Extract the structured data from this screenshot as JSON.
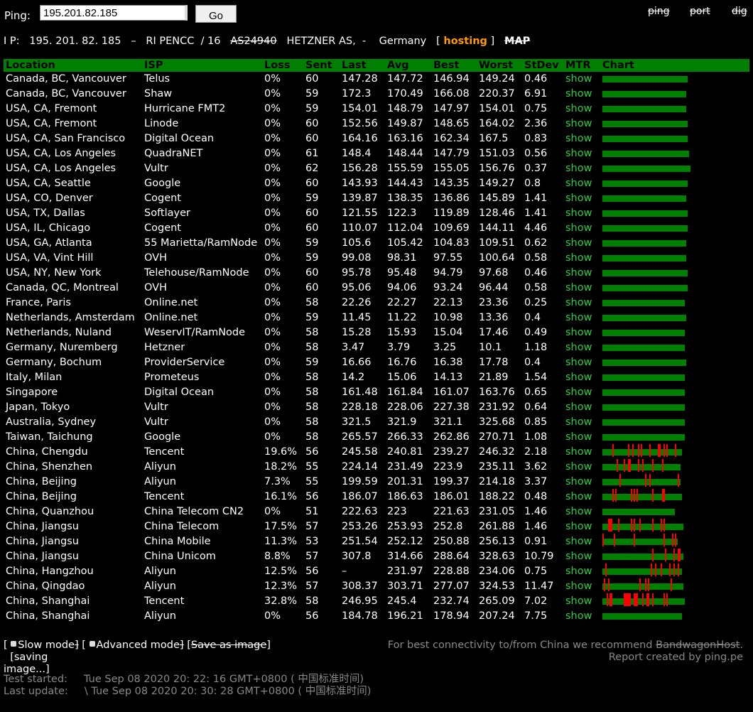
{
  "header": {
    "ping_label": "Ping:",
    "ping_value": "195.201.82.185",
    "go_label": "Go",
    "links": [
      "ping",
      "port",
      "dig"
    ]
  },
  "ipinfo": {
    "ip_label": "I P:",
    "ip": "195. 201. 82. 185",
    "sep1": "–",
    "registry": "RI PENCC",
    "prefix": "/ 16",
    "asn": "AS24940",
    "asname": "HETZNER AS,",
    "sep2": "-",
    "country": "Germany",
    "bracket_open": "[",
    "hosting": "hosting",
    "bracket_close": "]",
    "map": "MAP"
  },
  "table": {
    "columns": [
      "Location",
      "ISP",
      "Loss",
      "Sent",
      "Last",
      "Avg",
      "Best",
      "Worst",
      "StDev",
      "MTR",
      "Chart"
    ],
    "rows": [
      {
        "location": "Canada,  BC,  Vancouver",
        "isp": "Telus",
        "loss": "0%",
        "sent": "60",
        "last": "147.28",
        "avg": "147.72",
        "best": "146.94",
        "worst": "149.24",
        "stdev": "0.46",
        "mtr": "show"
      },
      {
        "location": "Canada,  BC,  Vancouver",
        "isp": "Shaw",
        "loss": "0%",
        "sent": "59",
        "last": "172.3",
        "avg": "170.49",
        "best": "166.08",
        "worst": "220.37",
        "stdev": "6.91",
        "mtr": "show"
      },
      {
        "location": "USA,  CA,  Fremont",
        "isp": "Hurricane    FMT2",
        "loss": "0%",
        "sent": "59",
        "last": "154.01",
        "avg": "148.79",
        "best": "147.97",
        "worst": "154.01",
        "stdev": "0.75",
        "mtr": "show"
      },
      {
        "location": "USA,  CA,  Fremont",
        "isp": "Linode",
        "loss": "0%",
        "sent": "60",
        "last": "152.56",
        "avg": "149.87",
        "best": "148.65",
        "worst": "164.02",
        "stdev": "2.36",
        "mtr": "show"
      },
      {
        "location": "USA,  CA,  San  Francisco",
        "isp": "Digital     Ocean",
        "loss": "0%",
        "sent": "60",
        "last": "164.16",
        "avg": "163.16",
        "best": "162.34",
        "worst": "167.5",
        "stdev": "0.83",
        "mtr": "show"
      },
      {
        "location": "USA,  CA,  Los  Angeles",
        "isp": "QuadraNET",
        "loss": "0%",
        "sent": "61",
        "last": "148.4",
        "avg": "148.44",
        "best": "147.79",
        "worst": "151.03",
        "stdev": "0.56",
        "mtr": "show"
      },
      {
        "location": "USA,  CA,  Los  Angeles",
        "isp": "Vultr",
        "loss": "0%",
        "sent": "62",
        "last": "156.28",
        "avg": "155.59",
        "best": "155.05",
        "worst": "156.76",
        "stdev": "0.37",
        "mtr": "show"
      },
      {
        "location": "USA,  CA,  Seattle",
        "isp": "Google",
        "loss": "0%",
        "sent": "60",
        "last": "143.93",
        "avg": "144.43",
        "best": "143.35",
        "worst": "149.27",
        "stdev": "0.8",
        "mtr": "show"
      },
      {
        "location": "USA,  CO,  Denver",
        "isp": "Cogent",
        "loss": "0%",
        "sent": "59",
        "last": "139.87",
        "avg": "138.35",
        "best": "136.86",
        "worst": "145.89",
        "stdev": "1.41",
        "mtr": "show"
      },
      {
        "location": "USA,  TX,  Dallas",
        "isp": "Softlayer",
        "loss": "0%",
        "sent": "60",
        "last": "121.55",
        "avg": "122.3",
        "best": "119.89",
        "worst": "128.46",
        "stdev": "1.41",
        "mtr": "show"
      },
      {
        "location": "USA,  IL,   Chicago",
        "isp": "Cogent",
        "loss": "0%",
        "sent": "60",
        "last": "110.07",
        "avg": "112.04",
        "best": "109.69",
        "worst": "144.11",
        "stdev": "4.46",
        "mtr": "show"
      },
      {
        "location": "USA,  GA,  Atlanta",
        "isp": "55  Marietta/RamNode",
        "loss": "0%",
        "sent": "59",
        "last": "105.6",
        "avg": "105.42",
        "best": "104.83",
        "worst": "109.51",
        "stdev": "0.62",
        "mtr": "show"
      },
      {
        "location": "USA,  VA,  Vint   Hill",
        "isp": "OVH",
        "loss": "0%",
        "sent": "59",
        "last": "99.08",
        "avg": "98.31",
        "best": "97.55",
        "worst": "100.64",
        "stdev": "0.58",
        "mtr": "show"
      },
      {
        "location": "USA,  NY,  New York",
        "isp": "Telehouse/RamNode",
        "loss": "0%",
        "sent": "60",
        "last": "95.78",
        "avg": "95.48",
        "best": "94.79",
        "worst": "97.68",
        "stdev": "0.46",
        "mtr": "show"
      },
      {
        "location": "Canada,   QC,  Montreal",
        "isp": "OVH",
        "loss": "0%",
        "sent": "60",
        "last": "95.06",
        "avg": "94.06",
        "best": "93.24",
        "worst": "96.44",
        "stdev": "0.58",
        "mtr": "show"
      },
      {
        "location": "France,     Paris",
        "isp": "Online.net",
        "loss": "0%",
        "sent": "58",
        "last": "22.26",
        "avg": "22.27",
        "best": "22.13",
        "worst": "23.36",
        "stdev": "0.25",
        "mtr": "show"
      },
      {
        "location": "Netherlands,     Amsterdam",
        "isp": "Online.net",
        "loss": "0%",
        "sent": "59",
        "last": "11.45",
        "avg": "11.22",
        "best": "10.98",
        "worst": "13.36",
        "stdev": "0.4",
        "mtr": "show"
      },
      {
        "location": "Netherlands,     Nuland",
        "isp": "WeservIT/RamNode",
        "loss": "0%",
        "sent": "58",
        "last": "15.28",
        "avg": "15.93",
        "best": "15.04",
        "worst": "17.46",
        "stdev": "0.49",
        "mtr": "show"
      },
      {
        "location": "Germany,   Nuremberg",
        "isp": "Hetzner",
        "loss": "0%",
        "sent": "58",
        "last": "3.47",
        "avg": "3.79",
        "best": "3.25",
        "worst": "10.1",
        "stdev": "1.18",
        "mtr": "show"
      },
      {
        "location": "Germany,   Bochum",
        "isp": "ProviderService",
        "loss": "0%",
        "sent": "59",
        "last": "16.66",
        "avg": "16.76",
        "best": "16.38",
        "worst": "17.78",
        "stdev": "0.4",
        "mtr": "show"
      },
      {
        "location": "Italy,      Milan",
        "isp": "Prometeus",
        "loss": "0%",
        "sent": "58",
        "last": "14.2",
        "avg": "15.06",
        "best": "14.13",
        "worst": "21.89",
        "stdev": "1.54",
        "mtr": "show"
      },
      {
        "location": "Singapore",
        "isp": "Digital     Ocean",
        "loss": "0%",
        "sent": "58",
        "last": "161.48",
        "avg": "161.84",
        "best": "161.07",
        "worst": "163.76",
        "stdev": "0.65",
        "mtr": "show"
      },
      {
        "location": "Japan,   Tokyo",
        "isp": "Vultr",
        "loss": "0%",
        "sent": "58",
        "last": "228.18",
        "avg": "228.06",
        "best": "227.38",
        "worst": "231.92",
        "stdev": "0.64",
        "mtr": "show"
      },
      {
        "location": "Australia,      Sydney",
        "isp": "Vultr",
        "loss": "0%",
        "sent": "58",
        "last": "321.5",
        "avg": "321.9",
        "best": "321.1",
        "worst": "325.68",
        "stdev": "0.85",
        "mtr": "show"
      },
      {
        "location": "Taiwan,   Taichung",
        "isp": "Google",
        "loss": "0%",
        "sent": "58",
        "last": "265.57",
        "avg": "266.33",
        "best": "262.86",
        "worst": "270.71",
        "stdev": "1.08",
        "mtr": "show"
      },
      {
        "location": "China,    Chengdu",
        "isp": "Tencent",
        "loss": "19.6%",
        "sent": "56",
        "last": "245.58",
        "avg": "240.81",
        "best": "239.27",
        "worst": "246.32",
        "stdev": "2.18",
        "mtr": "show"
      },
      {
        "location": "China,    Shenzhen",
        "isp": "Aliyun",
        "loss": "18.2%",
        "sent": "55",
        "last": "224.14",
        "avg": "231.49",
        "best": "223.9",
        "worst": "235.11",
        "stdev": "3.62",
        "mtr": "show"
      },
      {
        "location": "China,    Beijing",
        "isp": "Aliyun",
        "loss": "7.3%",
        "sent": "55",
        "last": "199.59",
        "avg": "201.31",
        "best": "199.37",
        "worst": "214.18",
        "stdev": "3.37",
        "mtr": "show"
      },
      {
        "location": "China,    Beijing",
        "isp": "Tencent",
        "loss": "16.1%",
        "sent": "56",
        "last": "186.07",
        "avg": "186.63",
        "best": "186.01",
        "worst": "188.22",
        "stdev": "0.48",
        "mtr": "show"
      },
      {
        "location": "China,    Quanzhou",
        "isp": "China   Telecom   CN2",
        "loss": "0%",
        "sent": "51",
        "last": "222.63",
        "avg": "223",
        "best": "221.63",
        "worst": "231.05",
        "stdev": "1.46",
        "mtr": "show"
      },
      {
        "location": "China,    Jiangsu",
        "isp": "China   Telecom",
        "loss": "17.5%",
        "sent": "57",
        "last": "253.26",
        "avg": "253.93",
        "best": "252.8",
        "worst": "261.88",
        "stdev": "1.46",
        "mtr": "show"
      },
      {
        "location": "China,    Jiangsu",
        "isp": "China   Mobile",
        "loss": "11.3%",
        "sent": "53",
        "last": "251.54",
        "avg": "252.12",
        "best": "250.88",
        "worst": "256.13",
        "stdev": "0.91",
        "mtr": "show"
      },
      {
        "location": "China,    Jiangsu",
        "isp": "China   Unicom",
        "loss": "8.8%",
        "sent": "57",
        "last": "307.8",
        "avg": "314.66",
        "best": "288.64",
        "worst": "328.63",
        "stdev": "10.79",
        "mtr": "show"
      },
      {
        "location": "China,    Hangzhou",
        "isp": "Aliyun",
        "loss": "12.5%",
        "sent": "56",
        "last": "–",
        "avg": "231.97",
        "best": "228.88",
        "worst": "234.06",
        "stdev": "0.75",
        "mtr": "show"
      },
      {
        "location": "China,    Qingdao",
        "isp": "Aliyun",
        "loss": "12.3%",
        "sent": "57",
        "last": "308.37",
        "avg": "303.71",
        "best": "277.07",
        "worst": "324.53",
        "stdev": "11.47",
        "mtr": "show"
      },
      {
        "location": "China,    Shanghai",
        "isp": "Tencent",
        "loss": "32.8%",
        "sent": "58",
        "last": "246.95",
        "avg": "245.4",
        "best": "232.74",
        "worst": "265.09",
        "stdev": "7.02",
        "mtr": "show"
      },
      {
        "location": "China,    Shanghai",
        "isp": "Aliyun",
        "loss": "0%",
        "sent": "56",
        "last": "184.78",
        "avg": "196.21",
        "best": "178.94",
        "worst": "207.24",
        "stdev": "7.75",
        "mtr": "show"
      }
    ]
  },
  "footer": {
    "open1": "[",
    "slow_mode": "Slow   mode",
    "close1": "]",
    "open2": "[",
    "advanced_mode": "Advanced   mode",
    "close2": "]",
    "open3": "[",
    "save_image": "Save   as   image",
    "close3": "]",
    "saving": "[saving",
    "saving2": "image...]",
    "recommend_prefix": "For   best   connectivity      to/from   China   we  recommend",
    "recommend_link": "BandwagonHost",
    "recommend_suffix": ".",
    "report": "Report   created    by  ping.pe",
    "started_label": "Test    started:",
    "started_value": "Tue  Sep  08  2020  20: 22: 16  GMT+0800  ( 中国标准时间)",
    "updated_label": "Last    update:",
    "updated_value": "\\ Tue  Sep  08  2020  20: 30: 28  GMT+0800  ( 中国标准时间)"
  },
  "colors": {
    "header_bg": "#008000",
    "ok": "#008000",
    "loss": "#ff0000",
    "link": "#2ecc40",
    "hosting": "#ff9900"
  }
}
